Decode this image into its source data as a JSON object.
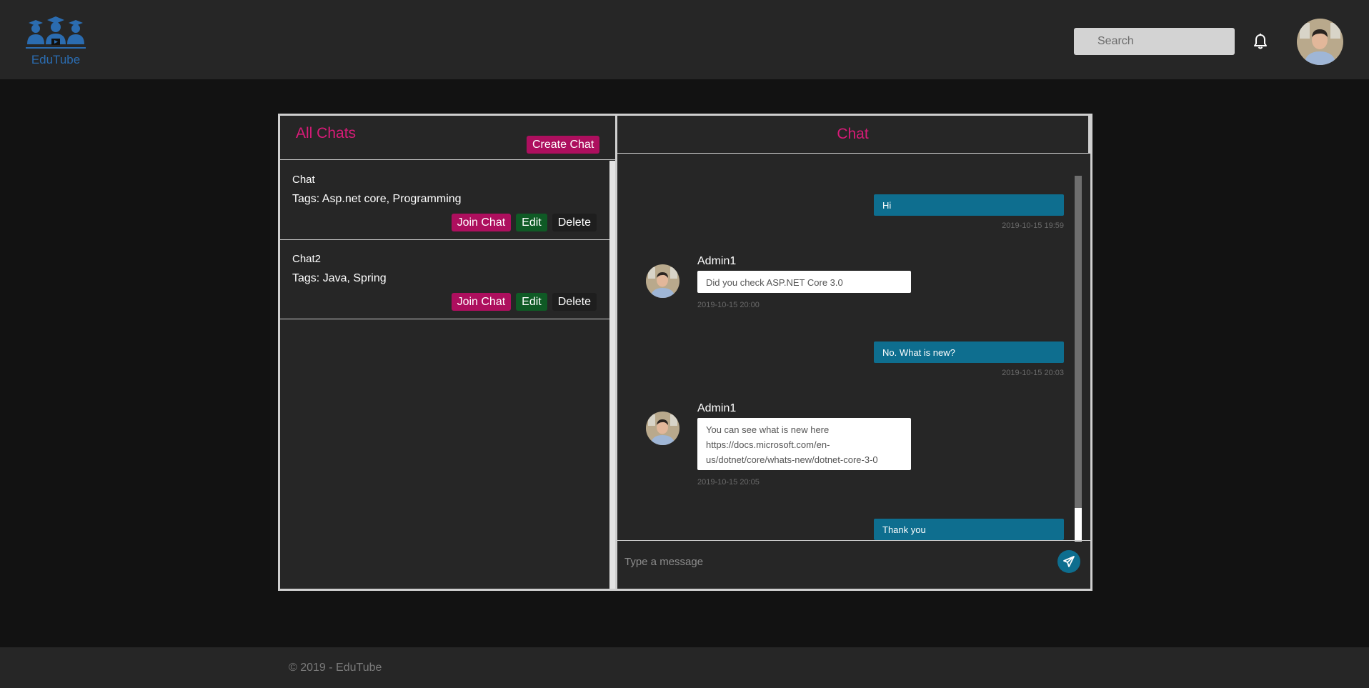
{
  "header": {
    "logo_text": "EduTube",
    "search_placeholder": "Search"
  },
  "left_panel": {
    "title": "All Chats",
    "create_label": "Create Chat",
    "chats": [
      {
        "name": "Chat",
        "tags": "Tags: Asp.net core, Programming",
        "join_label": "Join Chat",
        "edit_label": "Edit",
        "delete_label": "Delete"
      },
      {
        "name": "Chat2",
        "tags": "Tags: Java, Spring",
        "join_label": "Join Chat",
        "edit_label": "Edit",
        "delete_label": "Delete"
      }
    ]
  },
  "right_panel": {
    "title": "Chat",
    "messages": [
      {
        "direction": "out",
        "text": "Hi",
        "time": "2019-10-15 19:59"
      },
      {
        "direction": "in",
        "author": "Admin1",
        "text": "Did you check ASP.NET Core 3.0",
        "time": "2019-10-15 20:00"
      },
      {
        "direction": "out",
        "text": "No. What is new?",
        "time": "2019-10-15 20:03"
      },
      {
        "direction": "in",
        "author": "Admin1",
        "text": "You can see what is new here https://docs.microsoft.com/en-us/dotnet/core/whats-new/dotnet-core-3-0",
        "time": "2019-10-15 20:05"
      },
      {
        "direction": "out",
        "text": "Thank you",
        "time": ""
      }
    ],
    "input_placeholder": "Type a message"
  },
  "footer": {
    "copyright": "© 2019 - EduTube"
  },
  "colors": {
    "accent_pink": "#d81b78",
    "button_pink": "#ad0f5e",
    "button_green": "#0f5a25",
    "bubble_teal": "#0e6e8f",
    "brand_blue": "#2b6cb0"
  }
}
